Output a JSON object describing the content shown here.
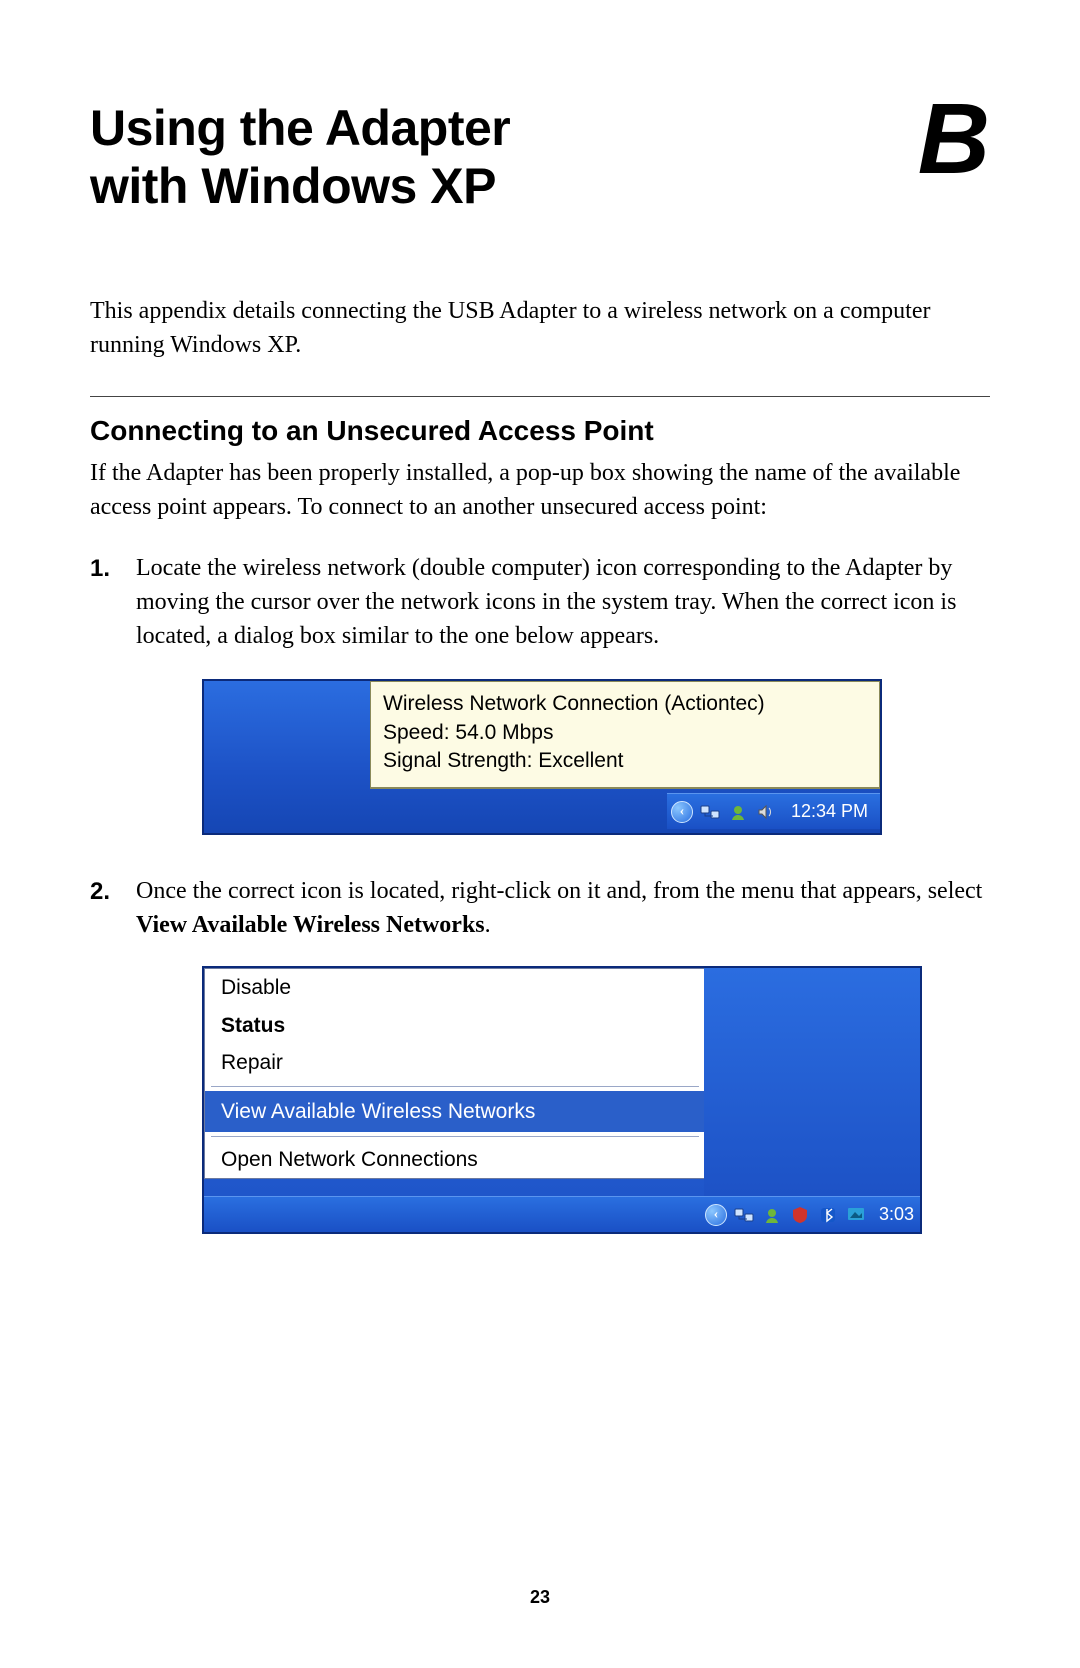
{
  "page_number": "23",
  "header": {
    "title_line1": "Using the Adapter",
    "title_line2": "with Windows XP",
    "appendix_letter": "B"
  },
  "intro": "This appendix details connecting the USB Adapter to a wireless network on a computer running Windows XP.",
  "section_heading": "Connecting to an Unsecured Access Point",
  "section_intro": "If the Adapter has been properly installed, a pop-up box showing the name of the available access point appears. To connect to an another unsecured access point:",
  "steps": [
    {
      "text": "Locate the wireless network (double computer) icon corresponding to the Adapter by moving the cursor over the network icons in the system tray. When the correct icon is located, a dialog box similar to the one below appears."
    },
    {
      "prefix": "Once the correct icon is located, right-click on it and, from the menu that appears, select ",
      "bold": "View Available Wireless Networks",
      "suffix": "."
    }
  ],
  "fig1": {
    "tooltip_line1": "Wireless Network Connection (Actiontec)",
    "tooltip_line2": "Speed: 54.0 Mbps",
    "tooltip_line3": "Signal Strength: Excellent",
    "tray_chevron": "‹",
    "clock": "12:34 PM"
  },
  "fig2": {
    "menu": {
      "disable": "Disable",
      "status": "Status",
      "repair": "Repair",
      "view": "View Available Wireless Networks",
      "open": "Open Network Connections"
    },
    "tray_chevron": "‹",
    "clock": "3:03"
  }
}
